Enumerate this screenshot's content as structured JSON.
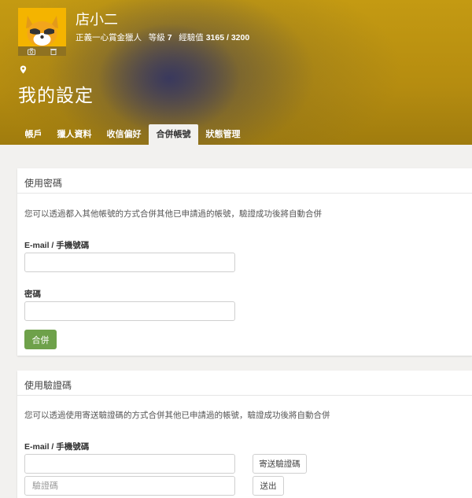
{
  "profile": {
    "name": "店小二",
    "title": "正義一心賞金獵人",
    "level_label": "等級",
    "level": "7",
    "exp_label": "經驗值",
    "exp": "3165 / 3200"
  },
  "page": {
    "title": "我的設定"
  },
  "tabs": [
    {
      "label": "帳戶",
      "active": false
    },
    {
      "label": "獵人資料",
      "active": false
    },
    {
      "label": "收信偏好",
      "active": false
    },
    {
      "label": "合併帳號",
      "active": true
    },
    {
      "label": "狀態管理",
      "active": false
    }
  ],
  "password_section": {
    "title": "使用密碼",
    "description": "您可以透過都入其他帳號的方式合併其他已申請過的帳號，驗證成功後將自動合併",
    "email_label": "E-mail / 手機號碼",
    "email_value": "",
    "password_label": "密碼",
    "password_value": "",
    "merge_button": "合併"
  },
  "code_section": {
    "title": "使用驗證碼",
    "description": "您可以透過使用寄送驗證碼的方式合併其他已申請過的帳號，驗證成功後將自動合併",
    "email_label": "E-mail / 手機號碼",
    "email_value": "",
    "send_code_button": "寄送驗證碼",
    "code_placeholder": "驗證碼",
    "submit_button": "送出"
  },
  "colors": {
    "header_gold": "#b58c10",
    "accent_green": "#6ea14a",
    "page_bg": "#f2f1ef"
  }
}
